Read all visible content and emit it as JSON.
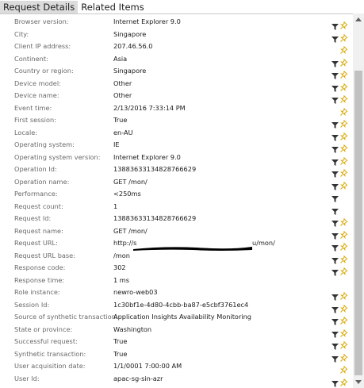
{
  "tabs": [
    {
      "label": "Request Details"
    },
    {
      "label": "Related Items"
    }
  ],
  "properties": [
    {
      "label": "Browser version:",
      "value": "Internet Explorer 9.0",
      "filter": true,
      "pin": true
    },
    {
      "label": "City:",
      "value": "Singapore",
      "filter": true,
      "pin": true
    },
    {
      "label": "Client IP address:",
      "value": "207.46.56.0",
      "filter": false,
      "pin": true
    },
    {
      "label": "Continent:",
      "value": "Asia",
      "filter": true,
      "pin": true
    },
    {
      "label": "Country or region:",
      "value": "Singapore",
      "filter": true,
      "pin": true
    },
    {
      "label": "Device model:",
      "value": "Other",
      "filter": true,
      "pin": true
    },
    {
      "label": "Device name:",
      "value": "Other",
      "filter": true,
      "pin": true
    },
    {
      "label": "Event time:",
      "value": "2/13/2016 7:33:14 PM",
      "filter": false,
      "pin": true
    },
    {
      "label": "First session:",
      "value": "True",
      "filter": true,
      "pin": true
    },
    {
      "label": "Locale:",
      "value": "en-AU",
      "filter": true,
      "pin": true
    },
    {
      "label": "Operating system:",
      "value": "IE",
      "filter": true,
      "pin": true
    },
    {
      "label": "Operating system version:",
      "value": "Internet Explorer 9.0",
      "filter": true,
      "pin": true
    },
    {
      "label": "Operation Id:",
      "value": "13883633134828766629",
      "filter": true,
      "pin": true
    },
    {
      "label": "Operation name:",
      "value": "GET /mon/",
      "filter": true,
      "pin": true
    },
    {
      "label": "Performance:",
      "value": "<250ms",
      "filter": true,
      "pin": false
    },
    {
      "label": "Request count:",
      "value": "1",
      "filter": true,
      "pin": false
    },
    {
      "label": "Request Id:",
      "value": "13883633134828766629",
      "filter": true,
      "pin": true
    },
    {
      "label": "Request name:",
      "value": "GET /mon/",
      "filter": true,
      "pin": true
    },
    {
      "label": "Request URL:",
      "value": "http://s",
      "value_suffix": "u/mon/",
      "redacted": true,
      "filter": true,
      "pin": true
    },
    {
      "label": "Request URL base:",
      "value": "/mon",
      "filter": true,
      "pin": true
    },
    {
      "label": "Response code:",
      "value": "302",
      "filter": true,
      "pin": true
    },
    {
      "label": "Response time:",
      "value": "1 ms",
      "filter": false,
      "pin": false
    },
    {
      "label": "Role instance:",
      "value": "newro-web03",
      "filter": true,
      "pin": true
    },
    {
      "label": "Session Id:",
      "value": "1c30bf1e-4d80-4cbb-ba87-e5cbf3761ec4",
      "filter": true,
      "pin": true
    },
    {
      "label": "Source of synthetic transaction:",
      "value": "Application Insights Availability Monitoring",
      "filter": true,
      "pin": true
    },
    {
      "label": "State or province:",
      "value": "Washington",
      "filter": true,
      "pin": true
    },
    {
      "label": "Successful request:",
      "value": "True",
      "filter": true,
      "pin": true
    },
    {
      "label": "Synthetic transaction:",
      "value": "True",
      "filter": true,
      "pin": true
    },
    {
      "label": "User acquisition date:",
      "value": "1/1/0001 7:00:00 AM",
      "filter": false,
      "pin": true
    },
    {
      "label": "User Id:",
      "value": "apac-sg-sin-azr",
      "filter": true,
      "pin": true
    }
  ],
  "colors": {
    "filter_icon": "#333333",
    "pin_icon": "#d9a600",
    "label_text": "#6a6a6a",
    "value_text": "#1a1a1a",
    "active_tab_bg": "#dcdcdc",
    "redaction": "#000000"
  },
  "icons": {
    "filter": "filter-icon",
    "pin": "pin-icon",
    "scroll_up": "chevron-up-icon",
    "scroll_down": "chevron-down-icon"
  }
}
